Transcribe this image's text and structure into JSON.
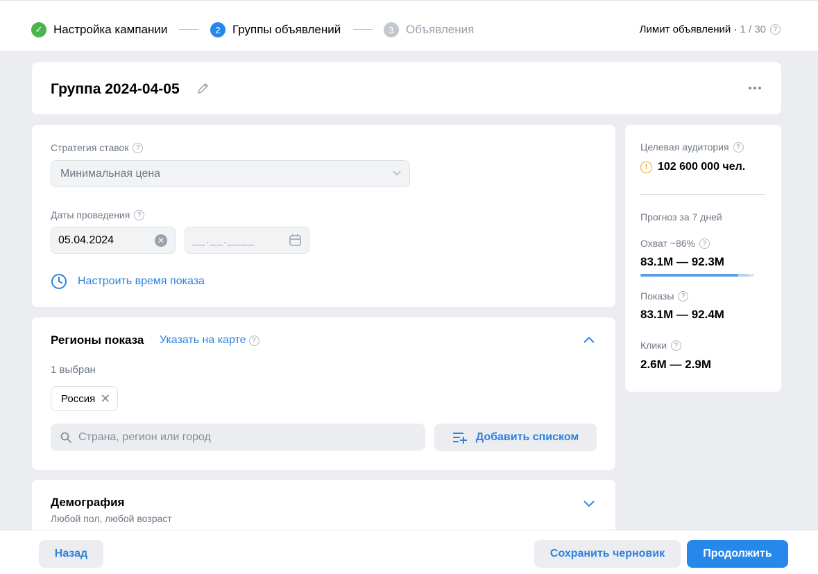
{
  "stepper": {
    "steps": [
      {
        "num": "✓",
        "label": "Настройка кампании"
      },
      {
        "num": "2",
        "label": "Группы объявлений"
      },
      {
        "num": "3",
        "label": "Объявления"
      }
    ],
    "limit_label": "Лимит объявлений ·",
    "limit_count": "1 / 30"
  },
  "group": {
    "title": "Группа 2024-04-05"
  },
  "strategy": {
    "label": "Стратегия ставок",
    "value": "Минимальная цена",
    "dates_label": "Даты проведения",
    "date_start": "05.04.2024",
    "date_end_placeholder": "__.__.____",
    "time_link": "Настроить время показа"
  },
  "regions": {
    "title": "Регионы показа",
    "map_link": "Указать на карте",
    "selected_count": "1 выбран",
    "chip": "Россия",
    "search_placeholder": "Страна, регион или город",
    "add_list_button": "Добавить списком"
  },
  "demography": {
    "title": "Демография",
    "subtitle": "Любой пол, любой возраст"
  },
  "audience": {
    "label": "Целевая аудитория",
    "count": "102 600 000 чел.",
    "forecast_label": "Прогноз за 7 дней",
    "reach_label": "Охват ~86%",
    "reach_value": "83.1M — 92.3M",
    "reach_progress": 0.86,
    "impressions_label": "Показы",
    "impressions_value": "83.1M — 92.4M",
    "clicks_label": "Клики",
    "clicks_value": "2.6M — 2.9M"
  },
  "footer": {
    "back": "Назад",
    "save_draft": "Сохранить черновик",
    "continue": "Продолжить"
  },
  "colors": {
    "accent": "#2688eb",
    "link": "#2d81e0",
    "success": "#4bb34b",
    "warning": "#f5a623"
  }
}
